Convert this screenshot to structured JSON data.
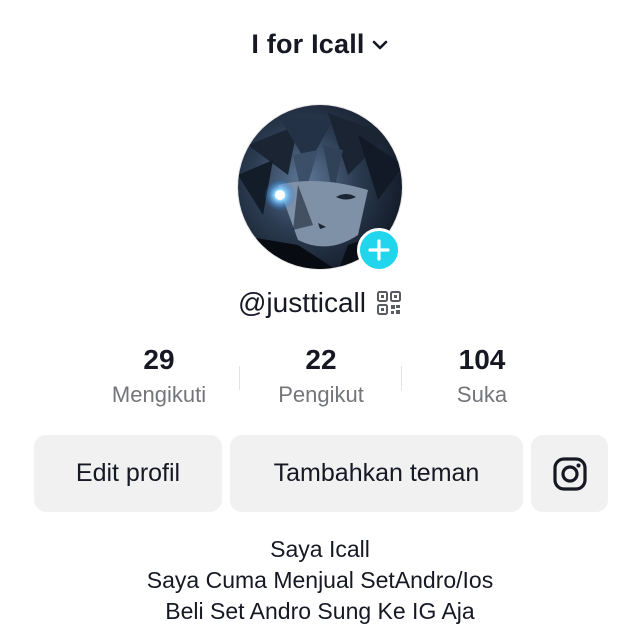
{
  "header": {
    "account_name": "I for Icall",
    "dropdown_icon": "chevron-down-icon"
  },
  "profile": {
    "avatar_icon": "avatar",
    "add_icon": "plus-icon",
    "accent_color": "#20d5ec",
    "handle": "@justticall",
    "qr_icon": "qr-code-icon"
  },
  "stats": [
    {
      "value": "29",
      "label": "Mengikuti"
    },
    {
      "value": "22",
      "label": "Pengikut"
    },
    {
      "value": "104",
      "label": "Suka"
    }
  ],
  "actions": {
    "edit_profile": "Edit profil",
    "add_friend": "Tambahkan teman",
    "instagram_icon": "instagram-icon"
  },
  "bio": [
    "Saya Icall",
    "Saya Cuma Menjual SetAndro/Ios",
    "Beli Set Andro Sung Ke IG Aja"
  ]
}
